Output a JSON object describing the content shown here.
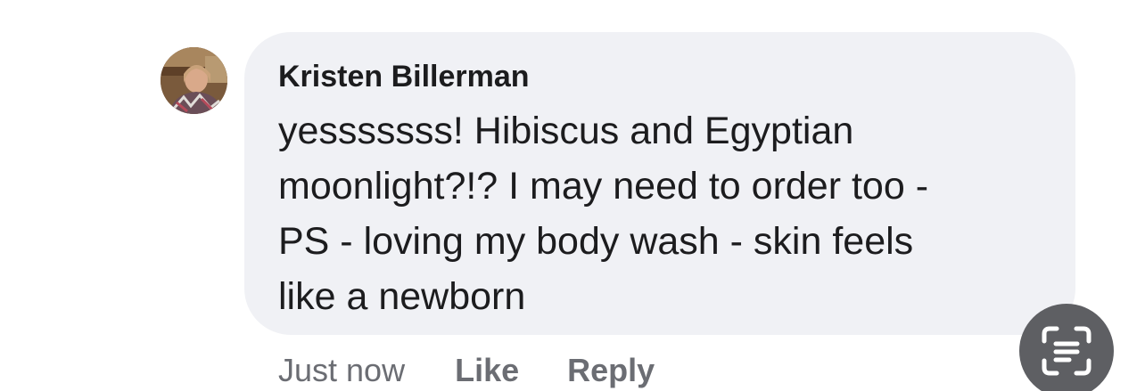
{
  "comment": {
    "author": "Kristen Billerman",
    "text_lines": [
      "yesssssss! Hibiscus and Egyptian",
      "moonlight?!? I may need to order too -",
      "PS - loving my body wash - skin feels",
      "like a newborn"
    ],
    "avatar_icon": "profile-photo",
    "bubble_color": "#f0f1f5"
  },
  "actions": {
    "timestamp": "Just now",
    "like_label": "Like",
    "reply_label": "Reply"
  },
  "overlay": {
    "live_text_icon": "live-text-scan-icon",
    "button_color": "#5e5f63"
  }
}
